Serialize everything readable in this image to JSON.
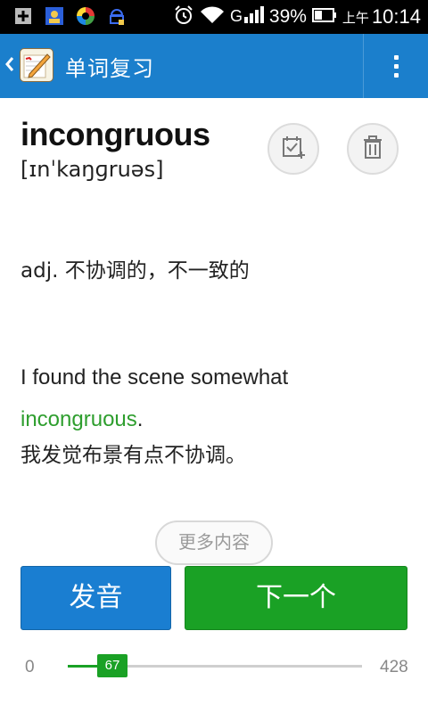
{
  "status_bar": {
    "battery_percent": "39%",
    "ampm": "上午",
    "time": "10:14",
    "network": "G"
  },
  "action_bar": {
    "title": "单词复习",
    "color": "#1b7fcc"
  },
  "word": {
    "text": "incongruous",
    "phonetic": "[ɪnˈkaŋɡruəs]",
    "definition": "adj. 不协调的，不一致的",
    "example_en_prefix": "I found the scene somewhat",
    "example_en_highlight": "incongruous",
    "example_en_suffix": ".",
    "example_zh": "我发觉布景有点不协调。"
  },
  "buttons": {
    "more": "更多内容",
    "pronounce": "发音",
    "next": "下一个"
  },
  "progress": {
    "min": "0",
    "current": "67",
    "max": "428"
  },
  "colors": {
    "accent_blue": "#1a7ed1",
    "accent_green": "#1aa125",
    "highlight_green": "#2e9e2e"
  }
}
